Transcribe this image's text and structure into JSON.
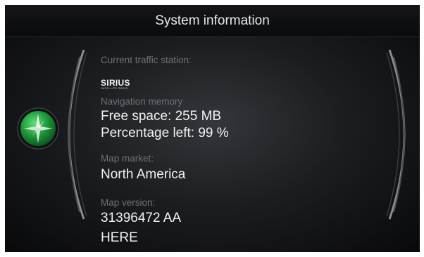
{
  "header": {
    "title": "System information"
  },
  "left_button": {
    "icon": "compass-icon",
    "color": "#2fa84a"
  },
  "info": {
    "traffic_label": "Current traffic station:",
    "traffic_logo": "SIRIUS",
    "traffic_logo_sub": "SATELLITE RADIO",
    "nav_memory_label": "Navigation memory",
    "free_space": "Free space: 255 MB",
    "percentage_left": "Percentage left: 99 %",
    "map_market_label": "Map market:",
    "map_market_value": "North America",
    "map_version_label": "Map version:",
    "map_version_value": "31396472 AA",
    "provider": "HERE"
  }
}
